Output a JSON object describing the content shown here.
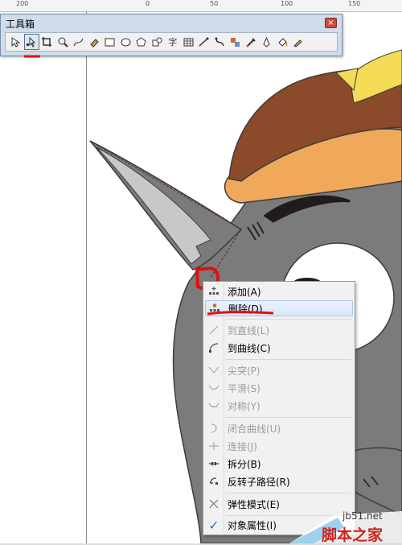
{
  "ruler": {
    "labels": [
      "200",
      "0",
      "50",
      "100",
      "150"
    ]
  },
  "toolbox": {
    "title": "工具箱",
    "close_symbol": "×",
    "tools": [
      {
        "name": "pick-tool-icon",
        "glyph": "pick"
      },
      {
        "name": "shape-tool-icon",
        "glyph": "shape",
        "active": true
      },
      {
        "name": "crop-tool-icon",
        "glyph": "crop"
      },
      {
        "name": "zoom-tool-icon",
        "glyph": "zoom"
      },
      {
        "name": "freehand-tool-icon",
        "glyph": "freehand"
      },
      {
        "name": "smart-fill-tool-icon",
        "glyph": "fill"
      },
      {
        "name": "rectangle-tool-icon",
        "glyph": "rect"
      },
      {
        "name": "ellipse-tool-icon",
        "glyph": "ellipse"
      },
      {
        "name": "polygon-tool-icon",
        "glyph": "polygon"
      },
      {
        "name": "basic-shapes-tool-icon",
        "glyph": "shapes"
      },
      {
        "name": "text-tool-icon",
        "glyph": "字"
      },
      {
        "name": "table-tool-icon",
        "glyph": "table"
      },
      {
        "name": "dimension-tool-icon",
        "glyph": "dimension"
      },
      {
        "name": "connector-tool-icon",
        "glyph": "connector"
      },
      {
        "name": "interactive-blend-tool-icon",
        "glyph": "blend"
      },
      {
        "name": "eyedropper-tool-icon",
        "glyph": "eyedropper"
      },
      {
        "name": "outline-pen-tool-icon",
        "glyph": "pen"
      },
      {
        "name": "fill-bucket-tool-icon",
        "glyph": "bucket"
      },
      {
        "name": "interactive-fill-tool-icon",
        "glyph": "ifill"
      }
    ]
  },
  "context_menu": {
    "items": [
      {
        "name": "menu-item-add",
        "label": "添加(A)",
        "enabled": true,
        "icon": "add-node-icon"
      },
      {
        "name": "menu-item-delete",
        "label": "删除(D)",
        "enabled": true,
        "icon": "delete-node-icon",
        "highlighted": true
      },
      {
        "name": "menu-item-to-line",
        "label": "到直线(L)",
        "enabled": false,
        "icon": "to-line-icon"
      },
      {
        "name": "menu-item-to-curve",
        "label": "到曲线(C)",
        "enabled": true,
        "icon": "to-curve-icon"
      },
      {
        "name": "menu-item-cusp",
        "label": "尖突(P)",
        "enabled": false,
        "icon": "cusp-icon"
      },
      {
        "name": "menu-item-smooth",
        "label": "平滑(S)",
        "enabled": false,
        "icon": "smooth-icon"
      },
      {
        "name": "menu-item-symmetric",
        "label": "对称(Y)",
        "enabled": false,
        "icon": "symmetric-icon"
      },
      {
        "name": "menu-item-close-curve",
        "label": "闭合曲线(U)",
        "enabled": false,
        "icon": "close-curve-icon"
      },
      {
        "name": "menu-item-join",
        "label": "连接(J)",
        "enabled": false,
        "icon": "join-icon"
      },
      {
        "name": "menu-item-break",
        "label": "拆分(B)",
        "enabled": true,
        "icon": "break-icon"
      },
      {
        "name": "menu-item-reverse-subpath",
        "label": "反转子路径(R)",
        "enabled": true,
        "icon": "reverse-subpath-icon"
      },
      {
        "name": "menu-item-elastic-mode",
        "label": "弹性模式(E)",
        "enabled": true,
        "icon": "elastic-mode-icon"
      },
      {
        "name": "menu-item-object-properties",
        "label": "对象属性(I)",
        "enabled": true,
        "icon": "checkmark-icon",
        "checked": true
      }
    ]
  },
  "watermark": {
    "url": "jb51.net",
    "site": "脚本之家"
  },
  "colors": {
    "fur_gray": "#7b7b7b",
    "ear_light": "#c8c8c8",
    "hat_brown": "#8b4a2a",
    "hat_brim": "#f0a95b",
    "hat_patch": "#f5dc57",
    "annotation_red": "#e01010",
    "menu_bg": "#f1f1f1",
    "highlight_border": "#a8c4ea"
  }
}
